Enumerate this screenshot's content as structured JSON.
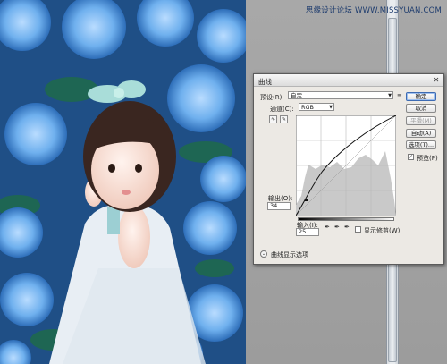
{
  "watermark": "思缘设计论坛 WWW.MISSYUAN.COM",
  "dialog": {
    "title": "曲线",
    "preset_label": "预设(R):",
    "preset_value": "自定",
    "preset_menu_icon": "≡",
    "channel_label": "通道(C):",
    "channel_value": "RGB",
    "output_label": "输出(O):",
    "output_value": "34",
    "input_label": "输入(I):",
    "input_value": "25",
    "show_clipping_label": "显示修剪(W)",
    "curve_options_label": "曲线显示选项",
    "buttons": {
      "ok": "确定",
      "cancel": "取消",
      "smooth": "平滑(M)",
      "auto": "自动(A)",
      "options": "选项(T)...",
      "preview": "预览(P)"
    }
  },
  "colors": {
    "dialog_bg": "#ece9e4",
    "histogram": "#c9c9c9",
    "curve": "#111111"
  }
}
